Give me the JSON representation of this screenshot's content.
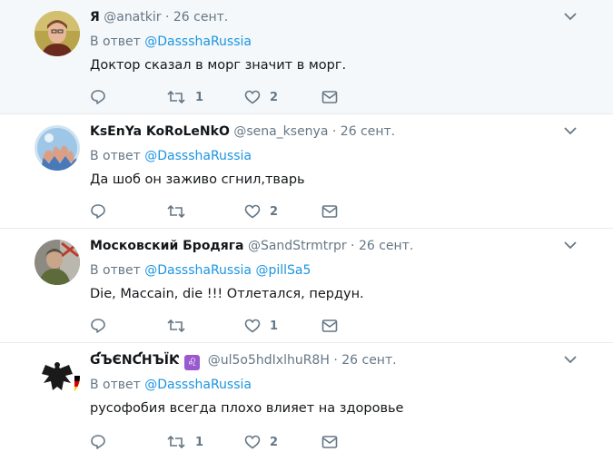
{
  "reply_prefix": "В ответ",
  "tweets": [
    {
      "name": "Я",
      "handle": "@anatkir",
      "time": "26 сент.",
      "reply_to": [
        "@DassshaRussia"
      ],
      "text": "Доктор сказал в морг значит в морг.",
      "retweets": "1",
      "likes": "2",
      "highlighted": true
    },
    {
      "name": "KsEnYa KoRoLeNkO",
      "handle": "@sena_ksenya",
      "time": "26 сент.",
      "reply_to": [
        "@DassshaRussia"
      ],
      "text": "Да шоб он заживо сгнил,тварь",
      "retweets": "",
      "likes": "2",
      "highlighted": false
    },
    {
      "name": "Московский Бродяга",
      "handle": "@SandStrmtrpr",
      "time": "26 сент.",
      "reply_to": [
        "@DasssһaRussia",
        "@pillSa5"
      ],
      "text": "Die, Maccain, die !!! Отлетался, пердун.",
      "retweets": "",
      "likes": "1",
      "highlighted": false
    },
    {
      "name": "ƓЪЄΝƇНЪЇƘ",
      "badge": "♌",
      "handle": "@ul5o5hdIxlhuR8H",
      "time": "26 сент.",
      "reply_to": [
        "@DasssһaRussia"
      ],
      "text": "русофобия всегда плохо влияет на здоровье",
      "retweets": "1",
      "likes": "2",
      "highlighted": false
    }
  ],
  "colors": {
    "link": "#1b95e0",
    "muted": "#657786",
    "highlight_bg": "#f5f8fa"
  },
  "icons": [
    "reply-icon",
    "retweet-icon",
    "like-icon",
    "direct-message-icon",
    "chevron-down-icon"
  ]
}
